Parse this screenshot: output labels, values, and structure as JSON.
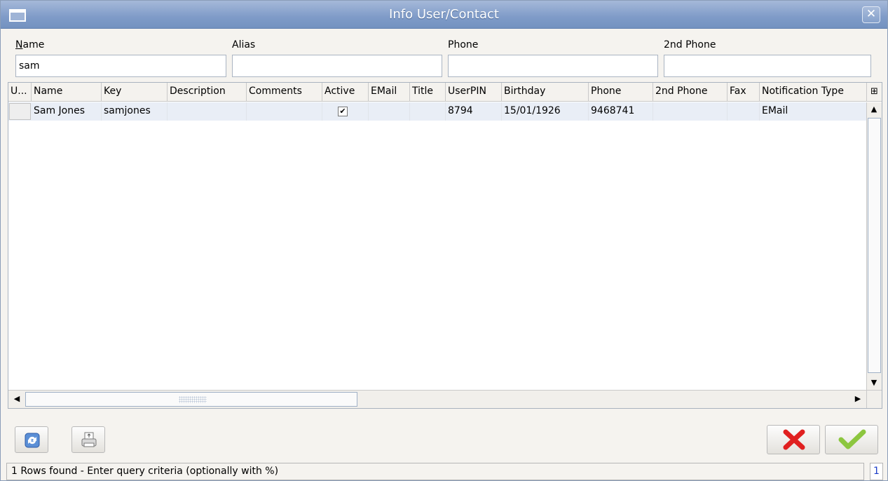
{
  "window": {
    "title": "Info User/Contact"
  },
  "filters": {
    "name_label_underlined": "N",
    "name_label_rest": "ame",
    "name_value": "sam",
    "alias_label": "Alias",
    "alias_value": "",
    "phone_label": "Phone",
    "phone_value": "",
    "phone2_label": "2nd Phone",
    "phone2_value": ""
  },
  "table": {
    "columns": [
      "U...",
      "Name",
      "Key",
      "Description",
      "Comments",
      "Active",
      "EMail",
      "Title",
      "UserPIN",
      "Birthday",
      "Phone",
      "2nd Phone",
      "Fax",
      "Notification Type"
    ],
    "rows": [
      {
        "name": "Sam Jones",
        "key": "samjones",
        "description": "",
        "comments": "",
        "active": "✔",
        "email": "",
        "title": "",
        "user_pin": "8794",
        "birthday": "15/01/1926",
        "phone": "9468741",
        "phone2": "",
        "fax": "",
        "notification_type": "EMail"
      }
    ],
    "corner_icon": "column-chooser-icon",
    "scroll_up": "▲",
    "scroll_down": "▼",
    "scroll_left": "◀",
    "scroll_right": "▶"
  },
  "toolbar": {
    "refresh_icon": "refresh-icon",
    "print_icon": "print-icon",
    "cancel_icon": "cancel-icon",
    "ok_icon": "ok-icon"
  },
  "status": {
    "message": "1 Rows found - Enter query criteria (optionally with %)",
    "count": "1"
  },
  "colors": {
    "title_bar": "#7f9bc8",
    "selected_row": "#e9eef6",
    "cancel_red": "#e02020",
    "ok_green": "#8cc63f"
  }
}
